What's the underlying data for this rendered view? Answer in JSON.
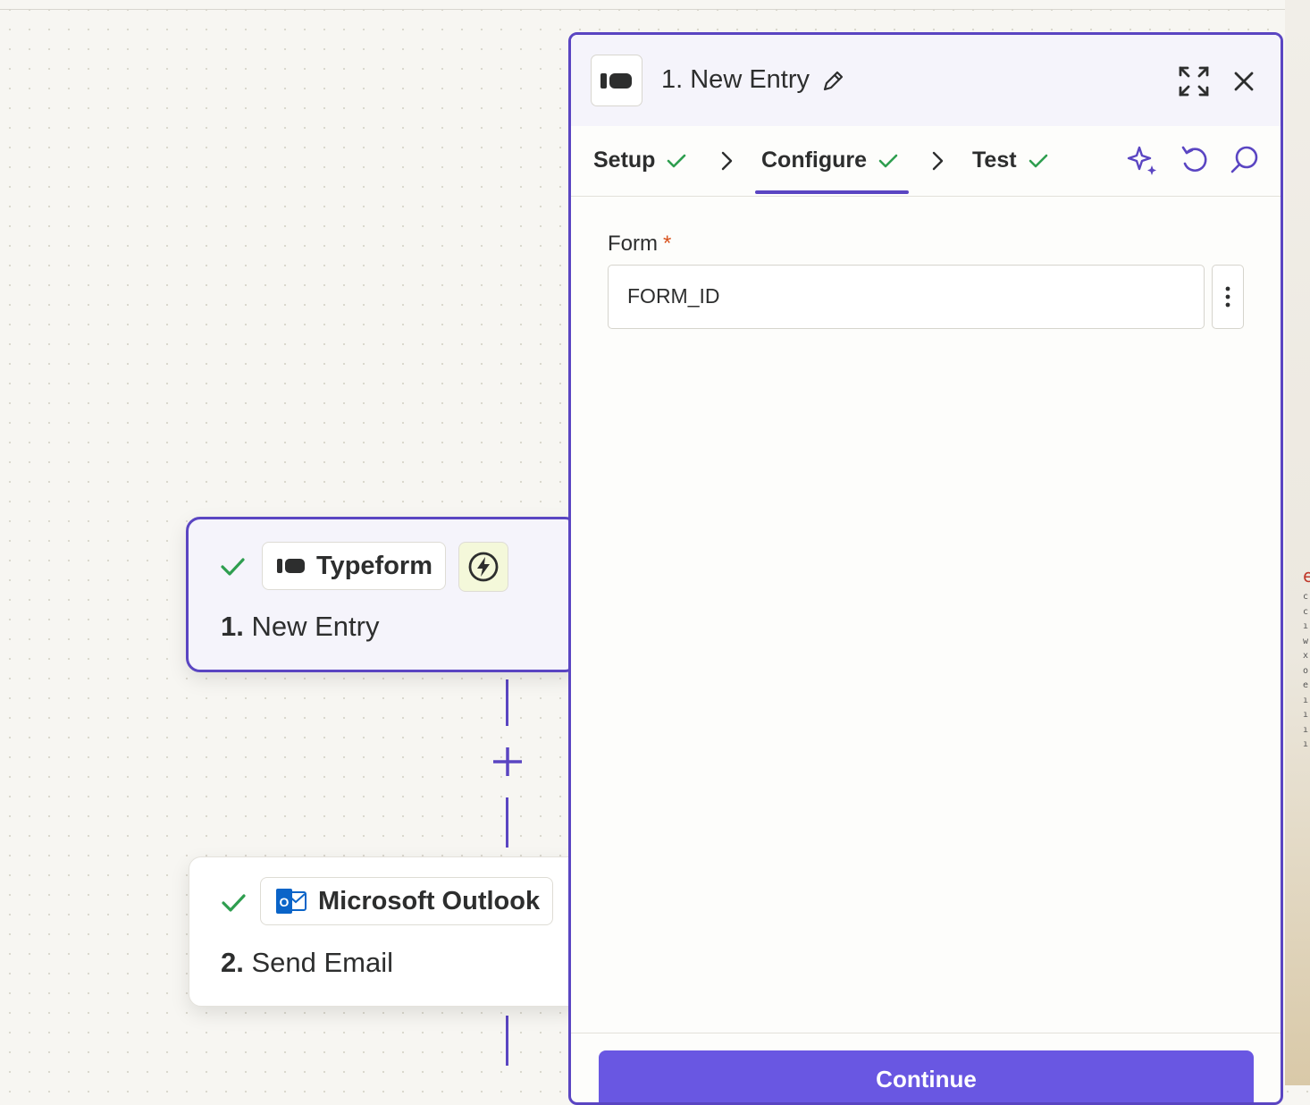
{
  "canvas": {
    "step1": {
      "app_name": "Typeform",
      "app_icon": "typeform-logo-icon",
      "trigger_icon": "lightning-bolt-icon",
      "number": "1.",
      "title": "New Entry",
      "status": "complete"
    },
    "step2": {
      "app_name": "Microsoft Outlook",
      "app_icon": "outlook-logo-icon",
      "number": "2.",
      "title": "Send Email",
      "status": "complete"
    },
    "add_step_icon": "plus-icon"
  },
  "panel": {
    "title": "1. New Entry",
    "tabs": [
      {
        "label": "Setup",
        "done": true
      },
      {
        "label": "Configure",
        "done": true,
        "active": true
      },
      {
        "label": "Test",
        "done": true
      }
    ],
    "form": {
      "label": "Form",
      "required_mark": "*",
      "value": "FORM_ID"
    },
    "continue_label": "Continue"
  },
  "background_log": {
    "error_glyph": "e",
    "lines": "c\nc\nı\nw\nx\no\ne\nı\nı\nı\nı"
  },
  "colors": {
    "accent": "#5a45c2",
    "button": "#6957e2",
    "success": "#2e9e4f",
    "required": "#d9531e"
  }
}
